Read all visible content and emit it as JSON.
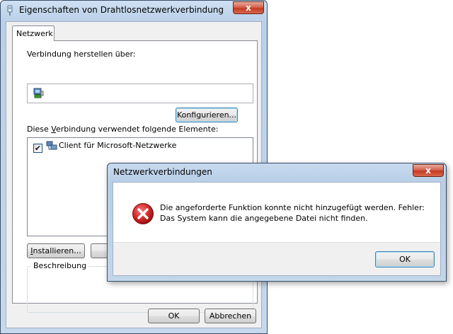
{
  "main_window": {
    "title": "Eigenschaften von Drahtlosnetzwerkverbindung",
    "close_label": "x",
    "tab_label": "Netzwerk",
    "connect_via_label": "Verbindung herstellen über:",
    "configure_label": "Konfigurieren...",
    "items_label_before": "Diese ",
    "items_label_accel": "V",
    "items_label_after": "erbindung verwendet folgende Elemente:",
    "components": [
      {
        "label": "Client für Microsoft-Netzwerke",
        "checked": true
      }
    ],
    "install_label_accel": "I",
    "install_label_rest": "nstallieren...",
    "description_label": "Beschreibung",
    "ok_label": "OK",
    "cancel_label": "Abbrechen"
  },
  "error_dialog": {
    "title": "Netzwerkverbindungen",
    "close_label": "x",
    "message_line1": "Die angeforderte Funktion konnte nicht hinzugefügt werden. Fehler:",
    "message_line2": "Das System kann die angegebene Datei nicht finden.",
    "ok_label": "OK"
  },
  "colors": {
    "error_red": "#d42a2a",
    "focus_border": "#3c7fb1"
  },
  "icons": {
    "title": "network-adapter-icon",
    "adapter": "network-adapter-icon",
    "client": "network-client-icon",
    "error": "error-icon"
  }
}
